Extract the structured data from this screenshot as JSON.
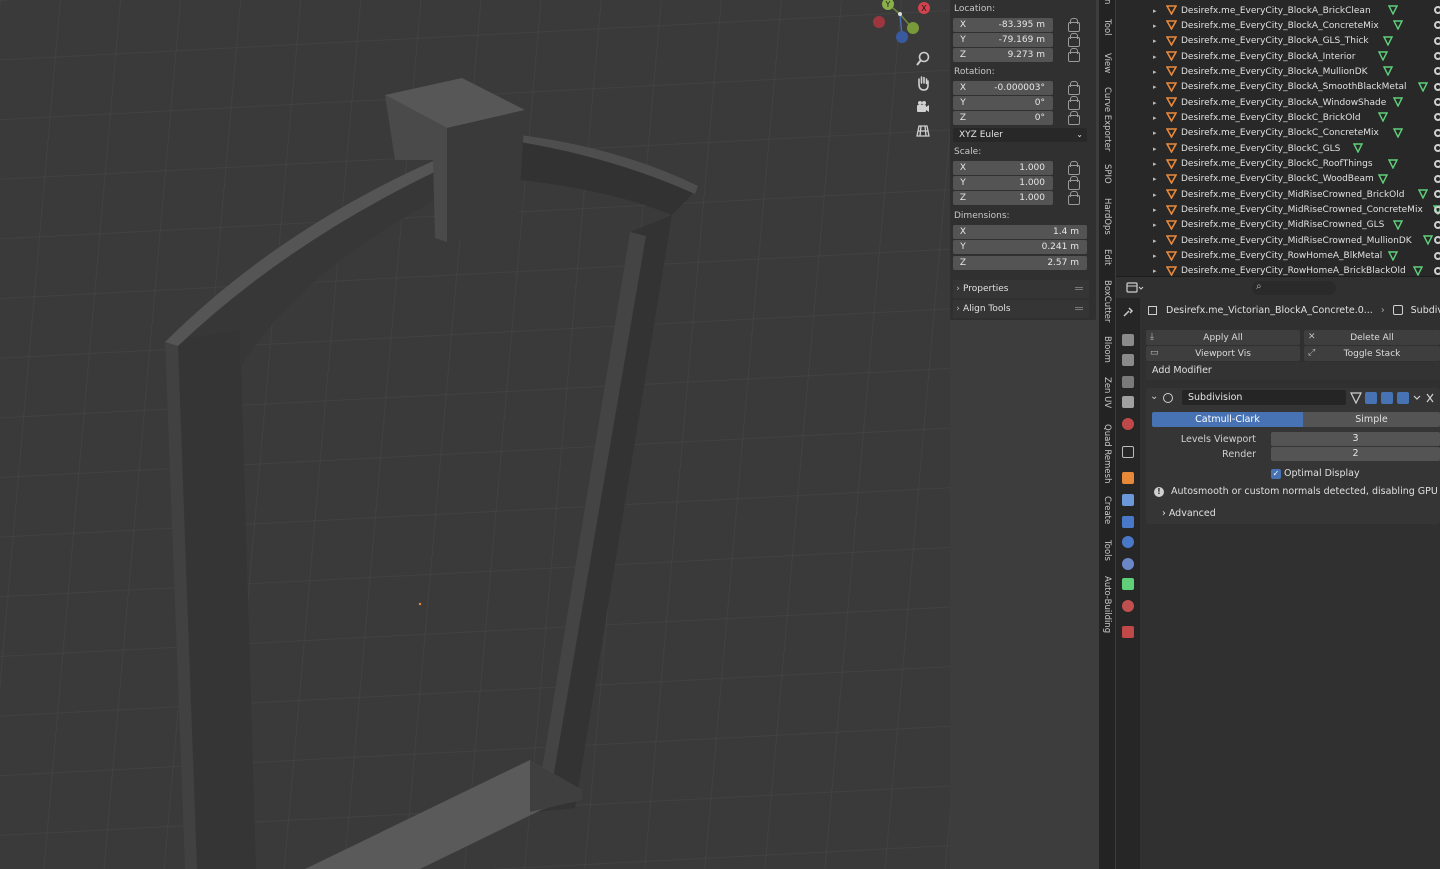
{
  "viewport": {
    "gizmo": {
      "x_label": "X",
      "y_label": "Y"
    },
    "nav_icons": [
      "zoom-icon",
      "hand-pan-icon",
      "camera-icon",
      "grid-ortho-icon"
    ]
  },
  "npanel": {
    "location_label": "Location:",
    "location": [
      {
        "axis": "X",
        "value": "-83.395 m"
      },
      {
        "axis": "Y",
        "value": "-79.169 m"
      },
      {
        "axis": "Z",
        "value": "9.273 m"
      }
    ],
    "rotation_label": "Rotation:",
    "rotation": [
      {
        "axis": "X",
        "value": "-0.000003°"
      },
      {
        "axis": "Y",
        "value": "0°"
      },
      {
        "axis": "Z",
        "value": "0°"
      }
    ],
    "rotation_mode": "XYZ Euler",
    "scale_label": "Scale:",
    "scale": [
      {
        "axis": "X",
        "value": "1.000"
      },
      {
        "axis": "Y",
        "value": "1.000"
      },
      {
        "axis": "Z",
        "value": "1.000"
      }
    ],
    "dimensions_label": "Dimensions:",
    "dimensions": [
      {
        "axis": "X",
        "value": "1.4 m"
      },
      {
        "axis": "Y",
        "value": "0.241 m"
      },
      {
        "axis": "Z",
        "value": "2.57 m"
      }
    ],
    "collapsibles": [
      "Properties",
      "Align Tools"
    ]
  },
  "tabs": [
    "n",
    "Tool",
    "View",
    "Curve Exporter",
    "SPIO",
    "HardOps",
    "Edit",
    "BoxCutter",
    "Bloom",
    "Zen UV",
    "Quad Remesh",
    "Create",
    "Tools",
    "Auto-Building"
  ],
  "outliner": {
    "items": [
      "Desirefx.me_EveryCity_BlockA_BrickClean",
      "Desirefx.me_EveryCity_BlockA_ConcreteMix",
      "Desirefx.me_EveryCity_BlockA_GLS_Thick",
      "Desirefx.me_EveryCity_BlockA_Interior",
      "Desirefx.me_EveryCity_BlockA_MullionDK",
      "Desirefx.me_EveryCity_BlockA_SmoothBlackMetal",
      "Desirefx.me_EveryCity_BlockA_WindowShade",
      "Desirefx.me_EveryCity_BlockC_BrickOld",
      "Desirefx.me_EveryCity_BlockC_ConcreteMix",
      "Desirefx.me_EveryCity_BlockC_GLS",
      "Desirefx.me_EveryCity_BlockC_RoofThings",
      "Desirefx.me_EveryCity_BlockC_WoodBeam",
      "Desirefx.me_EveryCity_MidRiseCrowned_BrickOld",
      "Desirefx.me_EveryCity_MidRiseCrowned_ConcreteMix",
      "Desirefx.me_EveryCity_MidRiseCrowned_GLS",
      "Desirefx.me_EveryCity_MidRiseCrowned_MullionDK",
      "Desirefx.me_EveryCity_RowHomeA_BlkMetal",
      "Desirefx.me_EveryCity_RowHomeA_BrickBlackOld"
    ],
    "accent_color": "#e8893a",
    "vertex_icon_color": "#5fcf7a"
  },
  "properties": {
    "breadcrumb_object": "Desirefx.me_Victorian_BlockA_Concrete.0...",
    "breadcrumb_modifier": "Subdivision",
    "apply_all": "Apply All",
    "delete_all": "Delete All",
    "viewport_vis": "Viewport Vis",
    "toggle_stack": "Toggle Stack",
    "add_modifier": "Add Modifier",
    "modifier": {
      "name": "Subdivision",
      "mode_catmull": "Catmull-Clark",
      "mode_simple": "Simple",
      "levels_viewport_label": "Levels Viewport",
      "levels_viewport": "3",
      "render_label": "Render",
      "render": "2",
      "optimal_display": "Optimal Display",
      "warning": "Autosmooth or custom normals detected, disabling GPU subdivi",
      "advanced": "Advanced"
    },
    "accent_color": "#4772b3"
  }
}
